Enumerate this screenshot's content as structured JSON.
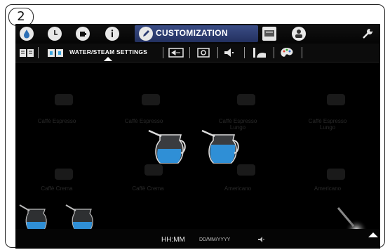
{
  "step_number": "2",
  "top_nav": {
    "active_tab_label": "CUSTOMIZATION",
    "icons": [
      "water-drop-icon",
      "clock-icon",
      "cup-icon",
      "info-icon",
      "pencil-icon",
      "display-icon",
      "user-icon",
      "wrench-icon"
    ]
  },
  "sub_nav": {
    "active_label": "WATER/STEAM SETTINGS",
    "icons": [
      "book-icon",
      "water-steam-icon",
      "screen-icon",
      "camera-icon",
      "speaker-icon",
      "cup-shelf-icon",
      "palette-icon"
    ]
  },
  "beverages": [
    {
      "label": "Caffè Espresso"
    },
    {
      "label": "Caffè Espresso"
    },
    {
      "label": "Caffè Espresso Lungo"
    },
    {
      "label": "Caffè Espresso Lungo"
    },
    {
      "label": "Caffè Crema"
    },
    {
      "label": "Caffè Crema"
    },
    {
      "label": "Americano"
    },
    {
      "label": "Americano"
    }
  ],
  "status_bar": {
    "time": "HH:MM",
    "date": "DD/MM/YYYY"
  },
  "colors": {
    "active_tab": "#2e3d73",
    "water": "#3aa6e0",
    "screen_bg": "#000000"
  }
}
